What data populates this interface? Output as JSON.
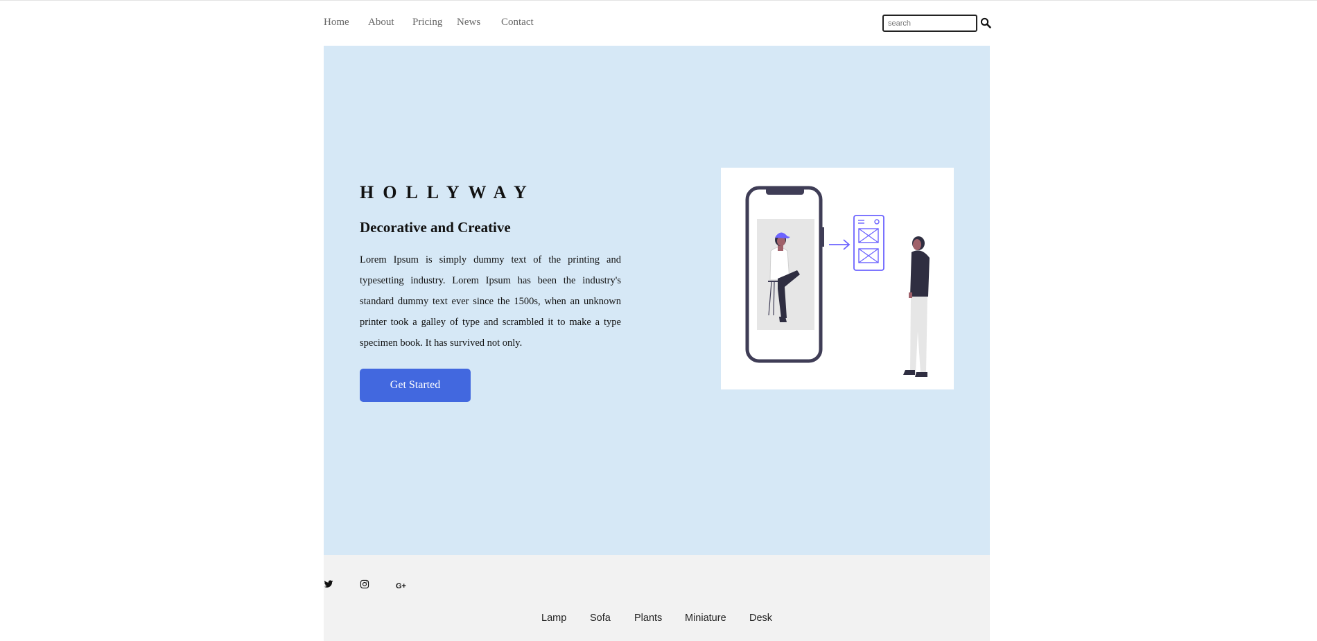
{
  "nav": {
    "links": [
      "Home",
      "About",
      "Pricing",
      "News",
      "Contact"
    ],
    "search_placeholder": "search",
    "search_icon": "magnifier-icon"
  },
  "hero": {
    "brand": "HOLLYWAY",
    "subtitle": "Decorative and Creative",
    "body": "Lorem Ipsum is simply dummy text of the printing and typesetting industry. Lorem Ipsum has been the industry's standard dummy text ever since the 1500s, when an unknown printer took a galley of type and scrambled it to make a type specimen book. It has survived not only.",
    "cta_label": "Get Started",
    "background_color": "#d6e8f6",
    "cta_color": "#4268df",
    "illustration": "person-with-smartphone-wireframe-illustration"
  },
  "footer": {
    "social": [
      "twitter-icon",
      "instagram-icon",
      "google-plus-icon"
    ],
    "gplus_label": "G+",
    "links": [
      "Lamp",
      "Sofa",
      "Plants",
      "Miniature",
      "Desk"
    ],
    "background_color": "#f2f2f2"
  }
}
